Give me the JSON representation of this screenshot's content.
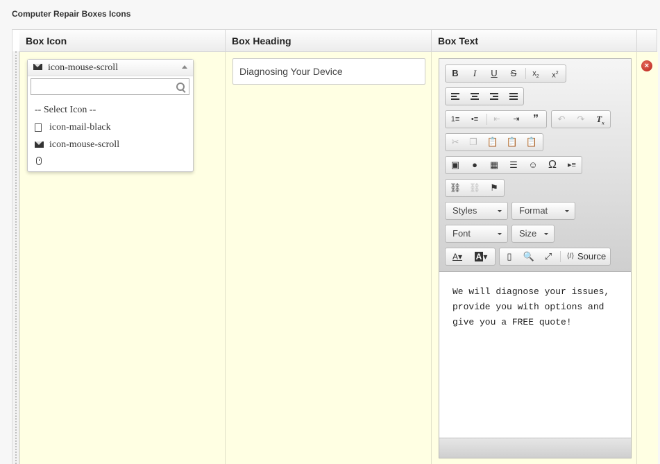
{
  "section_title": "Computer Repair Boxes Icons",
  "columns": [
    "Box Icon",
    "Box Heading",
    "Box Text"
  ],
  "icon_select": {
    "selected": "icon-mouse-scroll",
    "search_placeholder": "",
    "options": [
      {
        "label": "-- Select Icon --",
        "icon": ""
      },
      {
        "label": "icon-mail-black",
        "icon": "mail-black-icon"
      },
      {
        "label": "icon-mouse-scroll",
        "icon": "mail-icon"
      },
      {
        "label": "",
        "icon": "mouse-icon"
      }
    ]
  },
  "box_heading_value": "Diagnosing Your Device",
  "editor": {
    "combos": {
      "styles": "Styles",
      "format": "Format",
      "font": "Font",
      "size": "Size"
    },
    "source_label": "Source",
    "content": "We will diagnose your issues, provide you with options and give you a FREE quote!"
  }
}
